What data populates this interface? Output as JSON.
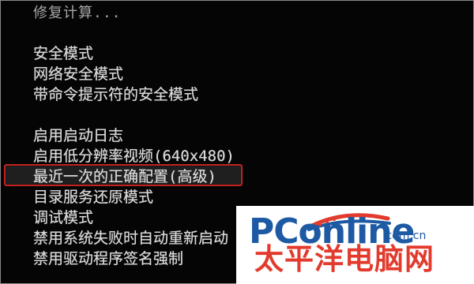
{
  "screen": {
    "top_text": "修复计算..."
  },
  "menu": {
    "items": [
      {
        "label": "安全模式"
      },
      {
        "label": "网络安全模式"
      },
      {
        "label": "带命令提示符的安全模式"
      },
      {
        "label": "启用启动日志"
      },
      {
        "label": "启用低分辨率视频(640x480)"
      },
      {
        "label": "最近一次的正确配置(高级)"
      },
      {
        "label": "目录服务还原模式"
      },
      {
        "label": "调试模式"
      },
      {
        "label": "禁用系统失败时自动重新启动"
      },
      {
        "label": "禁用驱动程序签名强制"
      }
    ],
    "selected_index": 5
  },
  "watermark": {
    "brand": "PConline",
    "domain": ".com.cn",
    "chinese_name": "太平洋电脑网"
  },
  "colors": {
    "background": "#050505",
    "menu_text": "#d8d8d8",
    "highlight_border": "#c42222",
    "logo_blue": "#1d5aa3",
    "logo_red": "#e23b2d"
  }
}
